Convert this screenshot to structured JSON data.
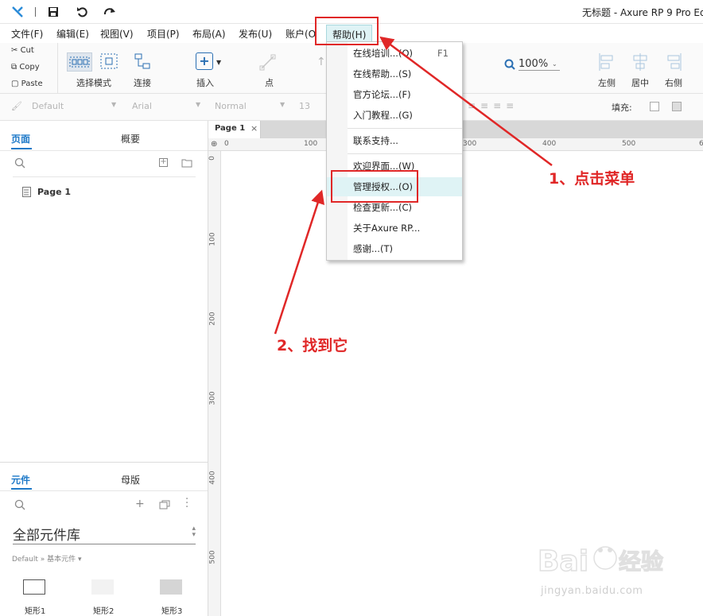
{
  "titlebar": {
    "title": "无标题 - Axure RP 9 Pro Ed"
  },
  "menu": {
    "items": [
      "文件(F)",
      "编辑(E)",
      "视图(V)",
      "项目(P)",
      "布局(A)",
      "发布(U)",
      "账户(O",
      "帮助(H)"
    ]
  },
  "clipboard": {
    "cut": "Cut",
    "copy": "Copy",
    "paste": "Paste"
  },
  "toolbar": {
    "select_mode": "选择模式",
    "connect": "连接",
    "insert": "插入",
    "point": "点",
    "zoom": "100%",
    "align_left": "左侧",
    "align_center": "居中",
    "align_right": "右侧"
  },
  "stylebar": {
    "style": "Default",
    "font": "Arial",
    "weight": "Normal",
    "size": "13",
    "fill_label": "填充:"
  },
  "pages_panel": {
    "tab_pages": "页面",
    "tab_outline": "概要",
    "page_item": "Page 1"
  },
  "widgets_panel": {
    "tab_widgets": "元件",
    "tab_masters": "母版",
    "library": "全部元件库",
    "breadcrumb": "Default » 基本元件 ▾",
    "widgets": [
      "矩形1",
      "矩形2",
      "矩形3"
    ]
  },
  "canvas": {
    "tab": "Page 1",
    "hruler": [
      "0",
      "100",
      "300",
      "400",
      "500",
      "6"
    ],
    "vruler": [
      "0",
      "100",
      "200",
      "300",
      "400",
      "500"
    ]
  },
  "help_menu": {
    "items": [
      {
        "label": "在线培训...(O)",
        "shortcut": "F1"
      },
      {
        "label": "在线帮助...(S)",
        "shortcut": ""
      },
      {
        "label": "官方论坛...(F)",
        "shortcut": ""
      },
      {
        "label": "入门教程...(G)",
        "shortcut": ""
      },
      {
        "label": "联系支持...",
        "shortcut": ""
      },
      {
        "label": "欢迎界面...(W)",
        "shortcut": ""
      },
      {
        "label": "管理授权...(O)",
        "shortcut": ""
      },
      {
        "label": "检查更新...(C)",
        "shortcut": ""
      },
      {
        "label": "关于Axure RP...",
        "shortcut": ""
      },
      {
        "label": "感谢...(T)",
        "shortcut": ""
      }
    ]
  },
  "annotations": {
    "step1": "1、点击菜单",
    "step2": "2、找到它",
    "watermark_site": "jingyan.baidu.com"
  },
  "colors": {
    "accent": "#1e79c8",
    "annotation": "#e02727",
    "highlight": "#dff3f5"
  }
}
